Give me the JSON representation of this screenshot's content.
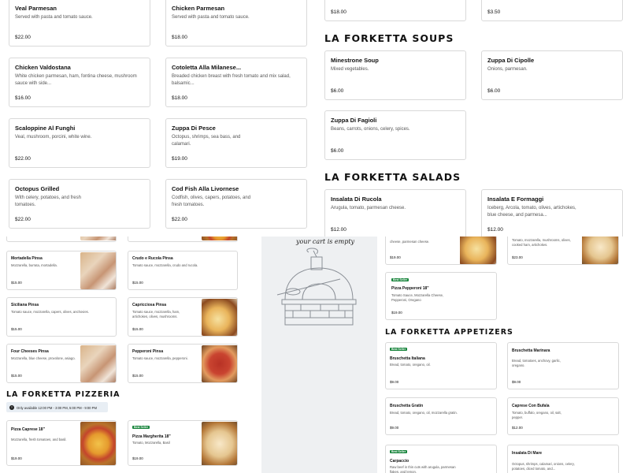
{
  "background": {
    "pinsa": [
      {
        "name": "Mortadella Pinsa",
        "desc": "Mozzarella, burrata, mortadella.",
        "price": "$15.00"
      },
      {
        "name": "Crudo e Rucola Pinsa",
        "desc": "Tomato sauce, mozzarella, crudo and rucola.",
        "price": "$15.00"
      },
      {
        "name": "Siciliana Pinsa",
        "desc": "Tomato sauce, mozzarella, capers, olives, anchovies.",
        "price": "$15.00"
      },
      {
        "name": "Capricciosa Pinsa",
        "desc": "Tomato sauce, mozzarella, ham, artichokes, olives, mushrooms.",
        "price": "$15.00"
      },
      {
        "name": "Four Cheeses Pinsa",
        "desc": "Mozzarella, blue cheese, provolone, asiago.",
        "price": "$15.00"
      },
      {
        "name": "Pepperoni Pinsa",
        "desc": "Tomato sauce, mozzarella, pepperoni.",
        "price": "$15.00"
      }
    ],
    "pizzeria_heading": "LA FORKETTA PIZZERIA",
    "pizzeria_notice": "Only available 12:00 PM - 3:00 PM, 5:00 PM - 9:00 PM",
    "pizzeria": [
      {
        "name": "Pizza Caprese 18\"",
        "desc": "Mozzarella, fresh tomatoes, and basil.",
        "price": "$19.00",
        "badge": ""
      },
      {
        "name": "Pizza Margherita 18\"",
        "desc": "Tomato, Mozzarella, Basil",
        "price": "$19.00",
        "badge": "Best Seller"
      }
    ],
    "cart_empty": "your cart is empty",
    "right_top": [
      {
        "desc": "cheese, parmesan cheese.",
        "price": "$19.00"
      },
      {
        "desc": "Tomato, mozzarella, mushrooms, olives, cooked ham, artichokes.",
        "price": "$23.00"
      }
    ],
    "pepperoni": {
      "badge": "Best Seller",
      "name": "Pizza Pepperoni 18\"",
      "desc": "Tomato Sauce, Mozzarella Cheese, Pepperoni, Oregano",
      "price": "$19.00"
    },
    "appetizers_heading": "LA FORKETTA APPETIZERS",
    "appetizers": [
      {
        "name": "Bruschetta Italiana",
        "desc": "Bread, tomato, oregano, oil.",
        "price": "$9.00",
        "badge": "Best Seller"
      },
      {
        "name": "Bruschetta Marinara",
        "desc": "Bread, tomatoes, anchovy, garlic, oregano.",
        "price": "$9.00",
        "badge": ""
      },
      {
        "name": "Bruschetta Gratin",
        "desc": "Bread, tomato, oregano, oil, mozzarella gratin.",
        "price": "$9.00",
        "badge": ""
      },
      {
        "name": "Caprese Con Bufala",
        "desc": "Tomato, buffalo, oregano, oil, salt, pepper.",
        "price": "$12.00",
        "badge": ""
      },
      {
        "name": "Carpaccio",
        "desc": "Raw beef in thin cuts with arugula, parmesan flakes, and lemon.",
        "price": "",
        "badge": "Best Seller"
      },
      {
        "name": "Insalata Di Mare",
        "desc": "Octopus, shrimps, calamari, onions, celery, potatoes, diced tomato, and...",
        "price": "",
        "badge": ""
      }
    ]
  },
  "foreground": {
    "left_cards": [
      {
        "name": "Veal Parmesan",
        "desc": "Served with pasta and tomato sauce.",
        "price": "$22.00"
      },
      {
        "name": "Chicken Parmesan",
        "desc": "Served with pasta and tomato sauce.",
        "price": "$18.00"
      },
      {
        "name": "Chicken Valdostana",
        "desc": "White chicken parmesan, ham, fontina cheese, mushroom sauce with side...",
        "price": "$16.00"
      },
      {
        "name": "Cotoletta Alla Milanese...",
        "desc": "Breaded chicken breast with fresh tomato and mix salad, balsamic...",
        "price": "$18.00"
      },
      {
        "name": "Scaloppine Al Funghi",
        "desc": "Veal, mushroom, porcini, white wine.",
        "price": "$22.00"
      },
      {
        "name": "Zuppa Di Pesce",
        "desc": "Octopus, shrimps, sea bass, and calamari.",
        "price": "$19.00"
      },
      {
        "name": "Octopus Grilled",
        "desc": "With celery, potatoes, and fresh tomatoes.",
        "price": "$22.00"
      },
      {
        "name": "Cod Fish Alla Livornese",
        "desc": "Codfish, olives, capers, potatoes, and fresh tomatoes.",
        "price": "$22.00"
      }
    ],
    "top_prices": [
      "$18.00",
      "$3.50"
    ],
    "soups_heading": "LA FORKETTA SOUPS",
    "soups": [
      {
        "name": "Minestrone Soup",
        "desc": "Mixed vegetables.",
        "price": "$6.00"
      },
      {
        "name": "Zuppa Di Cipolle",
        "desc": "Onions, parmesan.",
        "price": "$6.00"
      },
      {
        "name": "Zuppa Di Fagioli",
        "desc": "Beans, carrots, onions, celery, spices.",
        "price": "$6.00"
      }
    ],
    "salads_heading": "LA FORKETTA SALADS",
    "salads": [
      {
        "name": "Insalata Di Rucola",
        "desc": "Arugula, tomato, parmesan cheese.",
        "price": "$12.00"
      },
      {
        "name": "Insalata E Formaggi",
        "desc": "Iceberg, Arcola, tomato, olives, artichokes, blue cheese, and parmesa...",
        "price": "$12.00"
      }
    ]
  }
}
